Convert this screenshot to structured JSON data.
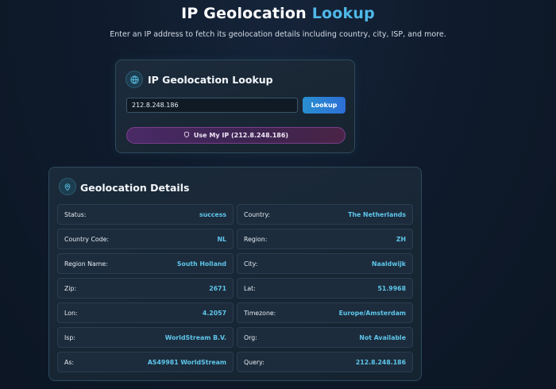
{
  "header": {
    "title_main": "IP Geolocation",
    "title_accent": "Lookup",
    "subtitle": "Enter an IP address to fetch its geolocation details including country, city, ISP, and more."
  },
  "lookup": {
    "heading": "IP Geolocation Lookup",
    "icon": "globe-icon",
    "ip_value": "212.8.248.186",
    "lookup_label": "Lookup",
    "my_ip_label": "Use My IP (212.8.248.186)",
    "my_ip_icon": "shield-icon"
  },
  "details": {
    "heading": "Geolocation Details",
    "icon": "map-pin-icon",
    "rows": [
      {
        "label": "Status:",
        "value": "success"
      },
      {
        "label": "Country:",
        "value": "The Netherlands"
      },
      {
        "label": "Country Code:",
        "value": "NL"
      },
      {
        "label": "Region:",
        "value": "ZH"
      },
      {
        "label": "Region Name:",
        "value": "South Holland"
      },
      {
        "label": "City:",
        "value": "Naaldwijk"
      },
      {
        "label": "Zip:",
        "value": "2671"
      },
      {
        "label": "Lat:",
        "value": "51.9968"
      },
      {
        "label": "Lon:",
        "value": "4.2057"
      },
      {
        "label": "Timezone:",
        "value": "Europe/Amsterdam"
      },
      {
        "label": "Isp:",
        "value": "WorldStream B.V."
      },
      {
        "label": "Org:",
        "value": "Not Available"
      },
      {
        "label": "As:",
        "value": "AS49981 WorldStream"
      },
      {
        "label": "Query:",
        "value": "212.8.248.186"
      }
    ]
  },
  "colors": {
    "accent": "#4fb8e8",
    "value_text": "#5ec6ec",
    "lookup_button": "#2a8fd0",
    "my_ip_button": "#4a2a66"
  }
}
